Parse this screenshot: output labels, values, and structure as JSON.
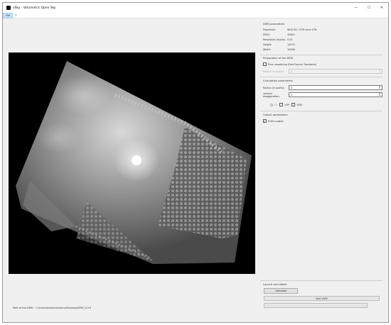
{
  "window": {
    "title": "vSky - Volumetric Open Sky",
    "minimize_glyph": "—",
    "maximize_glyph": "☐",
    "close_glyph": "✕"
  },
  "menu": {
    "items": [
      "File",
      "?"
    ]
  },
  "dem_params": {
    "title": "DEM parameters",
    "rows": [
      {
        "label": "Projection:",
        "value": "WGS 84 / UTM zone 47N"
      },
      {
        "label": "EPSG:",
        "value": "32647"
      },
      {
        "label": "Resolution (m/pix):",
        "value": "0.02"
      },
      {
        "label": "Height:",
        "value": "14075"
      },
      {
        "label": "Width:",
        "value": "12098"
      }
    ]
  },
  "dem_prep": {
    "title": "Preparation of the DEM",
    "prior_smoothing": {
      "label": "Prior smoothing (Fast Fourier Transform)",
      "checked": false
    },
    "radius": {
      "label": "Radius (in pixels):",
      "value": "2"
    }
  },
  "calc_params": {
    "title": "Calculation parameters",
    "radius": {
      "label": "Radius (in pixels):",
      "value": "5"
    },
    "vertical_exaggeration": {
      "label": "vertical exaggeration:",
      "value": "1"
    },
    "options": [
      {
        "label": "SO",
        "type": "radio",
        "checked": false
      },
      {
        "label": "VOP",
        "type": "checkbox",
        "checked": false
      },
      {
        "label": "VON",
        "type": "checkbox",
        "checked": false
      }
    ]
  },
  "output_params": {
    "title": "Output parameters",
    "tif_output": {
      "label": "8 bits output",
      "checked": true
    }
  },
  "launch": {
    "title": "Launch calculation",
    "calculate_label": "Calculate",
    "progress_label": "Visit VoPV",
    "progress_value": 0
  },
  "dem_path": {
    "label": "Path of the DEM:",
    "value": "C:/Users/Administrateur/Desktop/DEM_12.tif"
  },
  "colors": {
    "window_bg": "#f0f0f0",
    "viewer_bg": "#000000",
    "menu_active": "#cce4f7",
    "progress_fill": "#06b025"
  }
}
